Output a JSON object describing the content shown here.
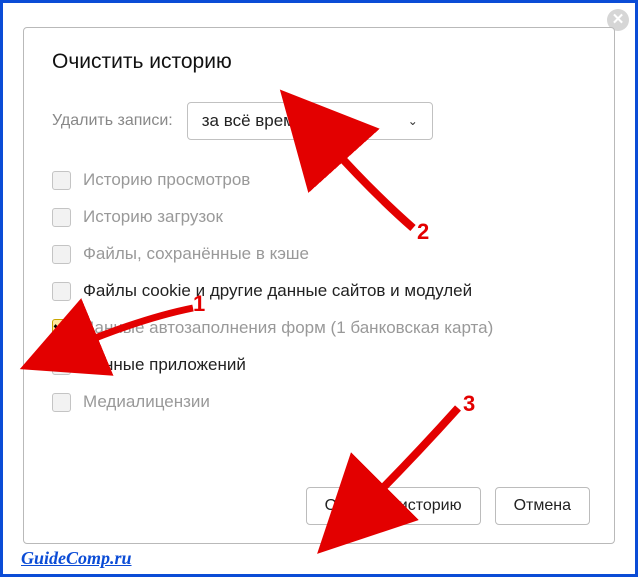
{
  "dialog": {
    "title": "Очистить историю",
    "deleteLabel": "Удалить записи:",
    "select": {
      "value": "за всё время"
    },
    "options": [
      {
        "label": "Историю просмотров",
        "checked": false,
        "muted": true,
        "suffix": ""
      },
      {
        "label": "Историю загрузок",
        "checked": false,
        "muted": true,
        "suffix": ""
      },
      {
        "label": "Файлы, сохранённые в кэше",
        "checked": false,
        "muted": true,
        "suffix": ""
      },
      {
        "label": "Файлы cookie и другие данные сайтов и модулей",
        "checked": false,
        "muted": false,
        "suffix": ""
      },
      {
        "label": "Данные автозаполнения форм",
        "checked": true,
        "muted": true,
        "suffix": "(1 банковская карта)"
      },
      {
        "label": "Данные приложений",
        "checked": false,
        "muted": false,
        "suffix": ""
      },
      {
        "label": "Медиалицензии",
        "checked": false,
        "muted": true,
        "suffix": ""
      }
    ],
    "buttons": {
      "clear": "Очистить историю",
      "cancel": "Отмена"
    }
  },
  "annotations": {
    "n1": "1",
    "n2": "2",
    "n3": "3"
  },
  "watermark": "GuideComp.ru"
}
